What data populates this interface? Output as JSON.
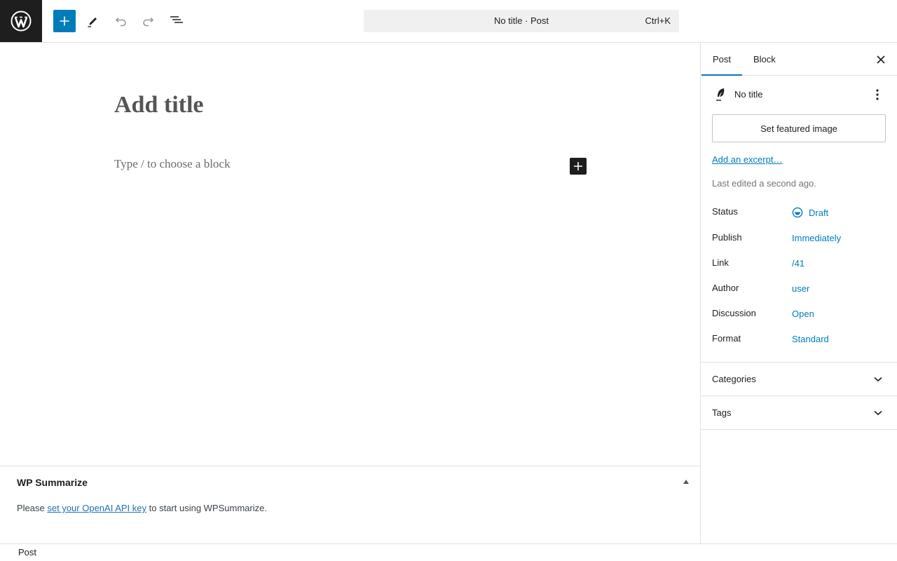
{
  "toolbar": {
    "command_title": "No title · Post",
    "command_shortcut": "Ctrl+K"
  },
  "editor": {
    "title_placeholder": "Add title",
    "block_placeholder": "Type / to choose a block"
  },
  "metabox": {
    "title": "WP Summarize",
    "text_before": "Please ",
    "link_text": "set your OpenAI API key",
    "text_after": " to start using WPSummarize."
  },
  "sidebar": {
    "tabs": [
      {
        "label": "Post"
      },
      {
        "label": "Block"
      }
    ],
    "post_name": "No title",
    "featured_image_label": "Set featured image",
    "excerpt_link": "Add an excerpt…",
    "last_edited": "Last edited a second ago.",
    "meta": [
      {
        "label": "Status",
        "value": "Draft"
      },
      {
        "label": "Publish",
        "value": "Immediately"
      },
      {
        "label": "Link",
        "value": "/41"
      },
      {
        "label": "Author",
        "value": "user"
      },
      {
        "label": "Discussion",
        "value": "Open"
      },
      {
        "label": "Format",
        "value": "Standard"
      }
    ],
    "panels": [
      {
        "label": "Categories"
      },
      {
        "label": "Tags"
      }
    ]
  },
  "footer": {
    "breadcrumb": "Post"
  },
  "colors": {
    "accent": "#007cba",
    "dark": "#1e1e1e",
    "border": "#e0e0e0"
  }
}
